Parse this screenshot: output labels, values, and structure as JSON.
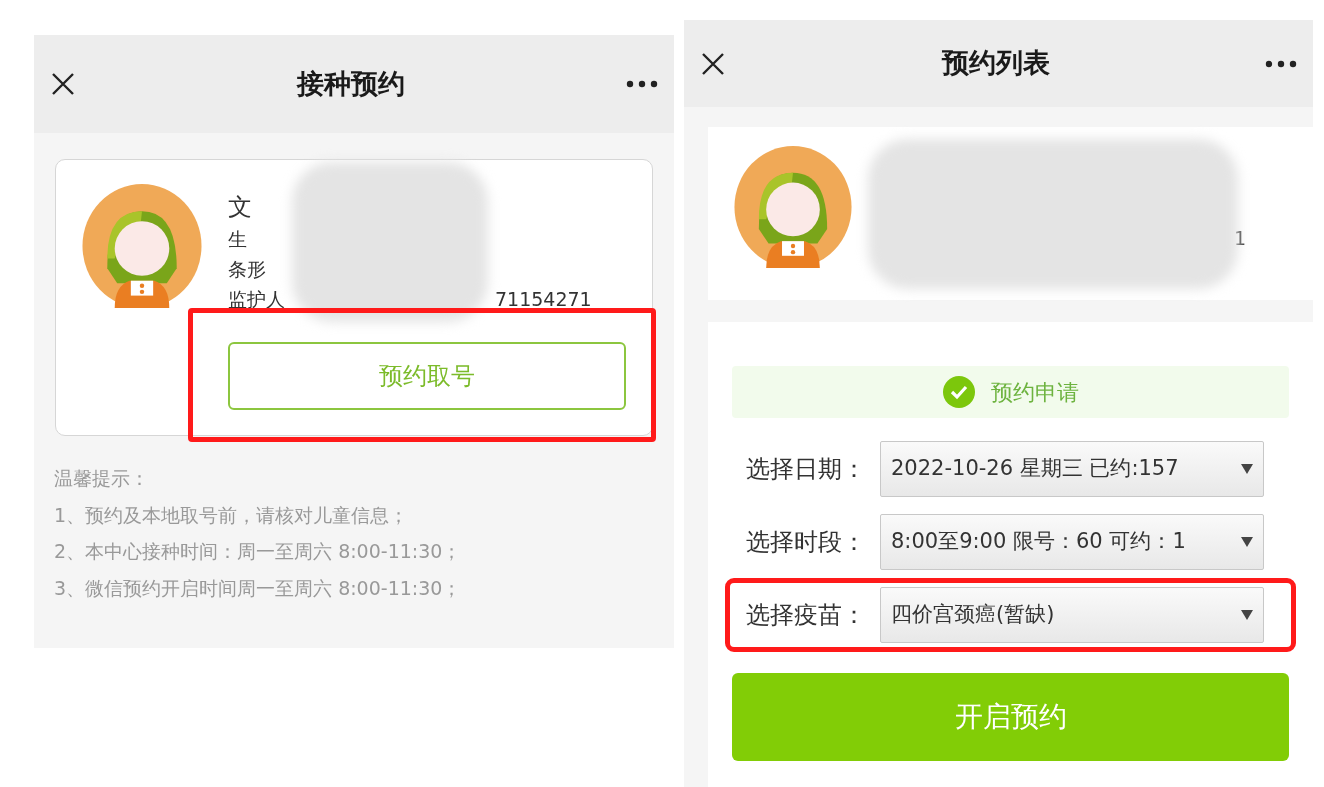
{
  "left_screen": {
    "title": "接种预约",
    "profile": {
      "lines": [
        {
          "label": "文"
        },
        {
          "label": "生"
        },
        {
          "label": "条形"
        },
        {
          "label": "监护人",
          "value": "71154271"
        }
      ]
    },
    "button": {
      "label": "预约取号",
      "highlighted": true
    },
    "tips": {
      "title": "温馨提示：",
      "items": [
        "1、预约及本地取号前，请核对儿童信息；",
        "2、本中心接种时间：周一至周六 8:00-11:30；",
        "3、微信预约开启时间周一至周六 8:00-11:30；"
      ]
    }
  },
  "right_screen": {
    "title": "预约列表",
    "profile": {
      "visible_text": "1"
    },
    "status": {
      "label": "预约申请"
    },
    "fields": [
      {
        "label": "选择日期：",
        "value": "2022-10-26 星期三 已约:157",
        "highlighted": false
      },
      {
        "label": "选择时段：",
        "value": "8:00至9:00 限号：60 可约：1",
        "highlighted": false
      },
      {
        "label": "选择疫苗：",
        "value": "四价宫颈癌(暂缺)",
        "highlighted": true
      }
    ],
    "submit": "开启预约"
  }
}
